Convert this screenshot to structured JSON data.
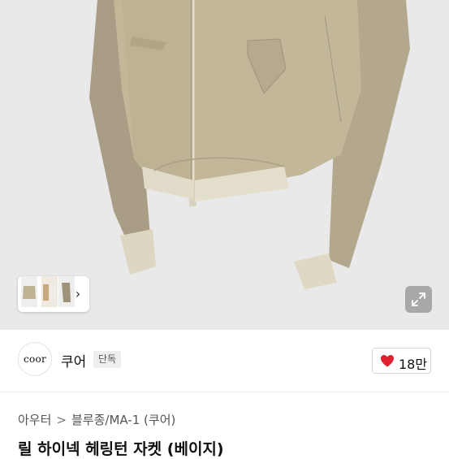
{
  "gallery": {
    "thumbnails": [
      "jacket-front",
      "jacket-duo",
      "jacket-side"
    ],
    "next_icon": "chevron-right-icon",
    "expand_icon": "expand-icon"
  },
  "seller": {
    "avatar_text": "coor",
    "name": "쿠어",
    "badge": "단독"
  },
  "likes": {
    "icon": "heart-icon",
    "count": "18만",
    "color": "#e0202e"
  },
  "breadcrumb": {
    "items": [
      "아우터",
      "블루종/MA-1 (쿠어)"
    ],
    "separator": ">"
  },
  "product": {
    "title": "릴 하이넥 헤링턴 자켓 (베이지)"
  }
}
